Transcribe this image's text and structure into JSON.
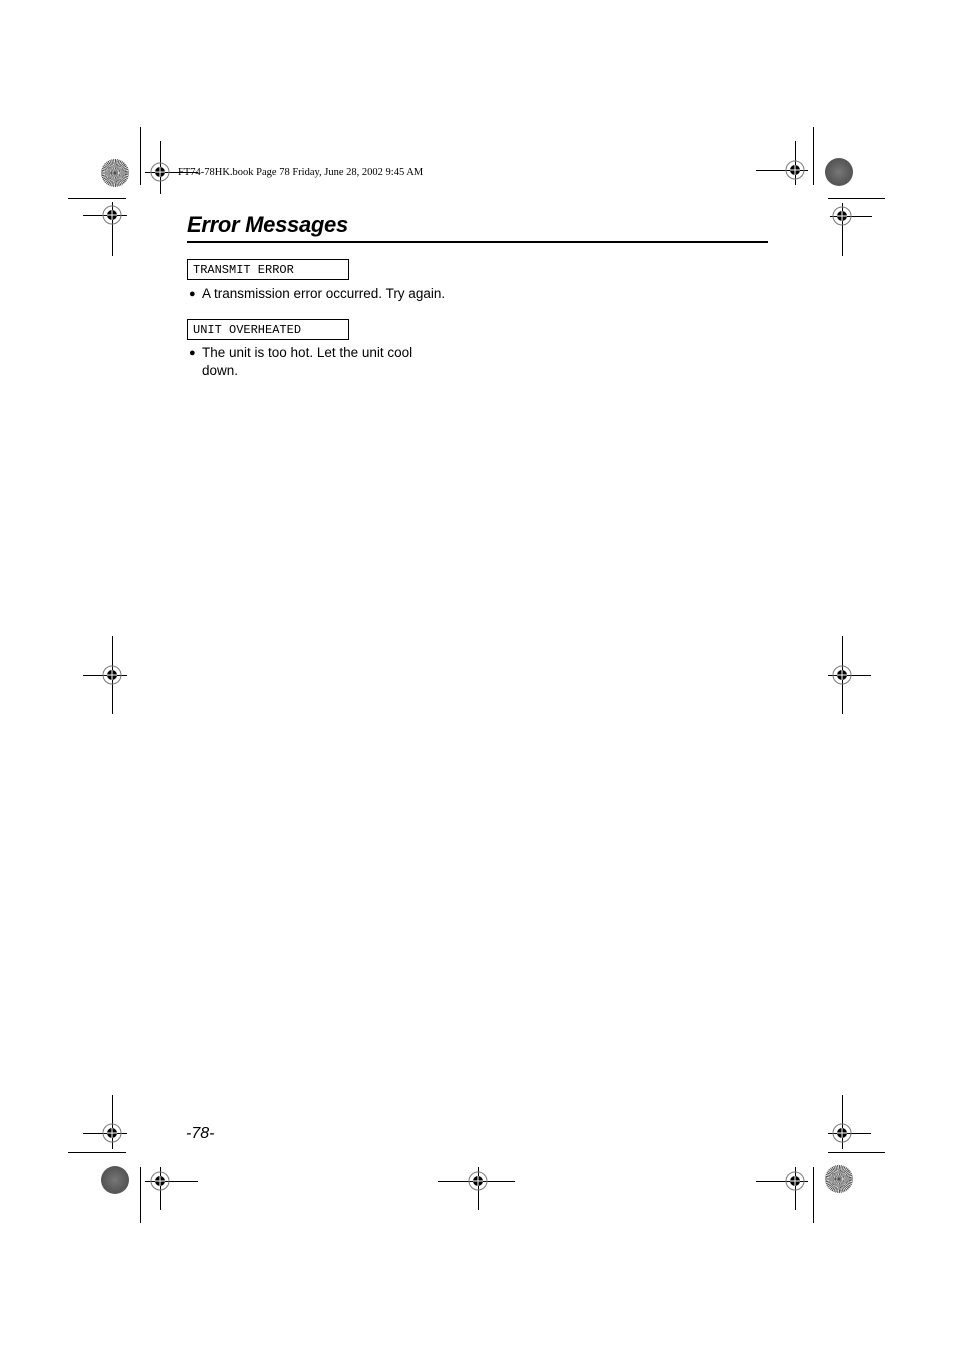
{
  "print_header": "FT74-78HK.book  Page 78  Friday, June 28, 2002  9:45 AM",
  "section": {
    "title": "Error Messages"
  },
  "messages": [
    {
      "display": "TRANSMIT ERROR",
      "bullet": "●",
      "description": "A transmission error occurred. Try again."
    },
    {
      "display": "UNIT OVERHEATED",
      "bullet": "●",
      "description": "The unit is too hot. Let the unit cool down."
    }
  ],
  "footer": {
    "page_number": "-78-"
  },
  "print_marks": {
    "registration_icon": "crosshair-target-icon",
    "color_bar_icons": [
      "starburst-disc-icon",
      "gray-disc-icon"
    ]
  }
}
